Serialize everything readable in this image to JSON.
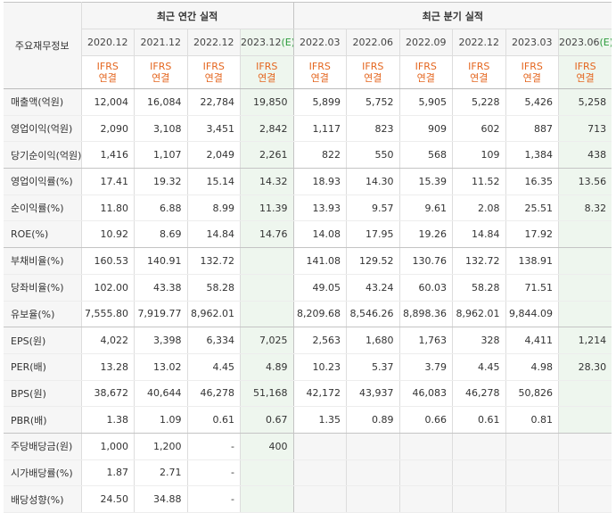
{
  "header": {
    "label_col": "주요재무정보",
    "annual_group": "최근 연간 실적",
    "quarter_group": "최근 분기 실적",
    "periods": [
      {
        "label": "2020.12",
        "suffix": ""
      },
      {
        "label": "2021.12",
        "suffix": ""
      },
      {
        "label": "2022.12",
        "suffix": ""
      },
      {
        "label": "2023.12",
        "suffix": "(E)"
      },
      {
        "label": "2022.03",
        "suffix": ""
      },
      {
        "label": "2022.06",
        "suffix": ""
      },
      {
        "label": "2022.09",
        "suffix": ""
      },
      {
        "label": "2022.12",
        "suffix": ""
      },
      {
        "label": "2023.03",
        "suffix": ""
      },
      {
        "label": "2023.06",
        "suffix": "(E)"
      }
    ],
    "ifrs_line1": "IFRS",
    "ifrs_line2": "연결"
  },
  "rows": [
    {
      "label": "매출액(억원)",
      "values": [
        "12,004",
        "16,084",
        "22,784",
        "19,850",
        "5,899",
        "5,752",
        "5,905",
        "5,228",
        "5,426",
        "5,258"
      ]
    },
    {
      "label": "영업이익(억원)",
      "values": [
        "2,090",
        "3,108",
        "3,451",
        "2,842",
        "1,117",
        "823",
        "909",
        "602",
        "887",
        "713"
      ]
    },
    {
      "label": "당기순이익(억원)",
      "values": [
        "1,416",
        "1,107",
        "2,049",
        "2,261",
        "822",
        "550",
        "568",
        "109",
        "1,384",
        "438"
      ]
    },
    {
      "label": "영업이익률(%)",
      "values": [
        "17.41",
        "19.32",
        "15.14",
        "14.32",
        "18.93",
        "14.30",
        "15.39",
        "11.52",
        "16.35",
        "13.56"
      ]
    },
    {
      "label": "순이익률(%)",
      "values": [
        "11.80",
        "6.88",
        "8.99",
        "11.39",
        "13.93",
        "9.57",
        "9.61",
        "2.08",
        "25.51",
        "8.32"
      ]
    },
    {
      "label": "ROE(%)",
      "values": [
        "10.92",
        "8.69",
        "14.84",
        "14.76",
        "14.08",
        "17.95",
        "19.26",
        "14.84",
        "17.92",
        ""
      ]
    },
    {
      "label": "부채비율(%)",
      "values": [
        "160.53",
        "140.91",
        "132.72",
        "",
        "141.08",
        "129.52",
        "130.76",
        "132.72",
        "138.91",
        ""
      ]
    },
    {
      "label": "당좌비율(%)",
      "values": [
        "102.00",
        "43.38",
        "58.28",
        "",
        "49.05",
        "43.24",
        "60.03",
        "58.28",
        "71.51",
        ""
      ]
    },
    {
      "label": "유보율(%)",
      "values": [
        "7,555.80",
        "7,919.77",
        "8,962.01",
        "",
        "8,209.68",
        "8,546.26",
        "8,898.36",
        "8,962.01",
        "9,844.09",
        ""
      ]
    },
    {
      "label": "EPS(원)",
      "values": [
        "4,022",
        "3,398",
        "6,334",
        "7,025",
        "2,563",
        "1,680",
        "1,763",
        "328",
        "4,411",
        "1,214"
      ]
    },
    {
      "label": "PER(배)",
      "values": [
        "13.28",
        "13.02",
        "4.45",
        "4.89",
        "10.23",
        "5.37",
        "3.79",
        "4.45",
        "4.98",
        "28.30"
      ]
    },
    {
      "label": "BPS(원)",
      "values": [
        "38,672",
        "40,644",
        "46,278",
        "51,168",
        "42,172",
        "43,937",
        "46,083",
        "46,278",
        "50,826",
        ""
      ]
    },
    {
      "label": "PBR(배)",
      "values": [
        "1.38",
        "1.09",
        "0.61",
        "0.67",
        "1.35",
        "0.89",
        "0.66",
        "0.61",
        "0.81",
        ""
      ]
    },
    {
      "label": "주당배당금(원)",
      "values": [
        "1,000",
        "1,200",
        "-",
        "400",
        "",
        "",
        "",
        "",
        "",
        ""
      ]
    },
    {
      "label": "시가배당률(%)",
      "values": [
        "1.87",
        "2.71",
        "-",
        "",
        "",
        "",
        "",
        "",
        "",
        ""
      ]
    },
    {
      "label": "배당성향(%)",
      "values": [
        "24.50",
        "34.88",
        "-",
        "",
        "",
        "",
        "",
        "",
        "",
        ""
      ]
    }
  ]
}
